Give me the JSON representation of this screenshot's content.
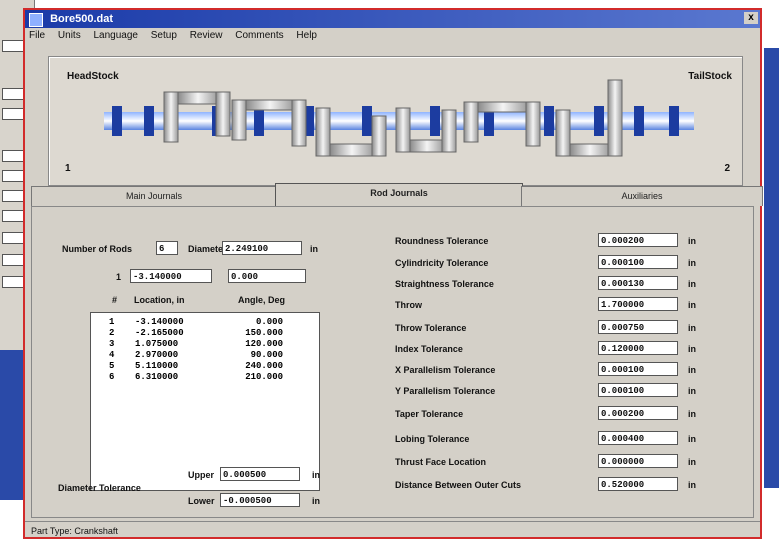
{
  "window": {
    "title": "Bore500.dat",
    "close": "x"
  },
  "menu": [
    "File",
    "Units",
    "Language",
    "Setup",
    "Review",
    "Comments",
    "Help"
  ],
  "shaft": {
    "headstock": "HeadStock",
    "tailstock": "TailStock",
    "left_num": "1",
    "right_num": "2"
  },
  "tabs": [
    "Main Journals",
    "Rod Journals",
    "Auxiliaries"
  ],
  "rod": {
    "num_rods_label": "Number of Rods",
    "num_rods": "6",
    "diameter_label": "Diameter",
    "diameter": "2.249100",
    "diameter_unit": "in",
    "row_index": "1",
    "cur_location": "-3.140000",
    "cur_angle": "0.000",
    "col_num": "#",
    "col_location": "Location, in",
    "col_angle": "Angle, Deg",
    "rows": [
      {
        "n": "1",
        "loc": "-3.140000",
        "ang": "0.000"
      },
      {
        "n": "2",
        "loc": "-2.165000",
        "ang": "150.000"
      },
      {
        "n": "3",
        "loc": "1.075000",
        "ang": "120.000"
      },
      {
        "n": "4",
        "loc": "2.970000",
        "ang": "90.000"
      },
      {
        "n": "5",
        "loc": "5.110000",
        "ang": "240.000"
      },
      {
        "n": "6",
        "loc": "6.310000",
        "ang": "210.000"
      }
    ],
    "diam_tol_label": "Diameter Tolerance",
    "upper_label": "Upper",
    "upper": "0.000500",
    "lower_label": "Lower",
    "lower": "-0.000500",
    "unit": "in"
  },
  "tolerances": [
    {
      "label": "Roundness Tolerance",
      "value": "0.000200",
      "unit": "in"
    },
    {
      "label": "Cylindricity Tolerance",
      "value": "0.000100",
      "unit": "in"
    },
    {
      "label": "Straightness Tolerance",
      "value": "0.000130",
      "unit": "in"
    },
    {
      "label": "Throw",
      "value": "1.700000",
      "unit": "in"
    },
    {
      "label": "Throw Tolerance",
      "value": "0.000750",
      "unit": "in"
    },
    {
      "label": "Index Tolerance",
      "value": "0.120000",
      "unit": "in"
    },
    {
      "label": "X Parallelism Tolerance",
      "value": "0.000100",
      "unit": "in"
    },
    {
      "label": "Y Parallelism Tolerance",
      "value": "0.000100",
      "unit": "in"
    },
    {
      "label": "Taper Tolerance",
      "value": "0.000200",
      "unit": "in"
    },
    {
      "label": "Lobing Tolerance",
      "value": "0.000400",
      "unit": "in"
    },
    {
      "label": "Thrust Face Location",
      "value": "0.000000",
      "unit": "in"
    },
    {
      "label": "Distance Between Outer Cuts",
      "value": "0.520000",
      "unit": "in"
    }
  ],
  "status": "Part Type: Crankshaft"
}
